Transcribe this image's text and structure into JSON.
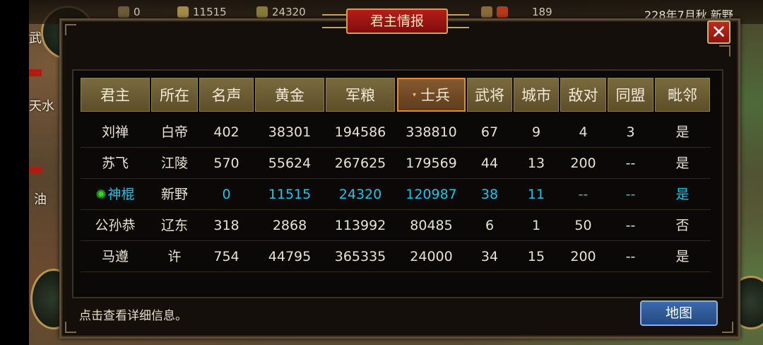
{
  "topbar": {
    "res1_value": "0",
    "res2_value": "11515",
    "res3_value": "24320",
    "res4_value": "189",
    "date_text": "228年7月秋 新野"
  },
  "map": {
    "label_tianshui": "天水",
    "label_wu": "武",
    "label_you": "油"
  },
  "dialog": {
    "title": "君主情报",
    "close_label": "✕",
    "hint": "点击查看详细信息。",
    "map_button": "地图"
  },
  "columns": [
    "君主",
    "所在",
    "名声",
    "黄金",
    "军粮",
    "士兵",
    "武将",
    "城市",
    "敌对",
    "同盟",
    "毗邻"
  ],
  "sorted_column_index": 5,
  "sort_indicator": "▾",
  "player_icon": "sun-icon",
  "highlight_color": "#25c2e8",
  "rows": [
    [
      "刘禅",
      "白帝",
      "402",
      "38301",
      "194586",
      "338810",
      "67",
      "9",
      "4",
      "3",
      "是"
    ],
    [
      "苏飞",
      "江陵",
      "570",
      "55624",
      "267625",
      "179569",
      "44",
      "13",
      "200",
      "--",
      "是"
    ],
    [
      "神棍",
      "新野",
      "0",
      "11515",
      "24320",
      "120987",
      "38",
      "11",
      "--",
      "--",
      "是"
    ],
    [
      "公孙恭",
      "辽东",
      "318",
      "2868",
      "113992",
      "80485",
      "6",
      "1",
      "50",
      "--",
      "否"
    ],
    [
      "马遵",
      "许",
      "754",
      "44795",
      "365335",
      "24000",
      "34",
      "15",
      "200",
      "--",
      "是"
    ]
  ],
  "player_row_index": 2
}
